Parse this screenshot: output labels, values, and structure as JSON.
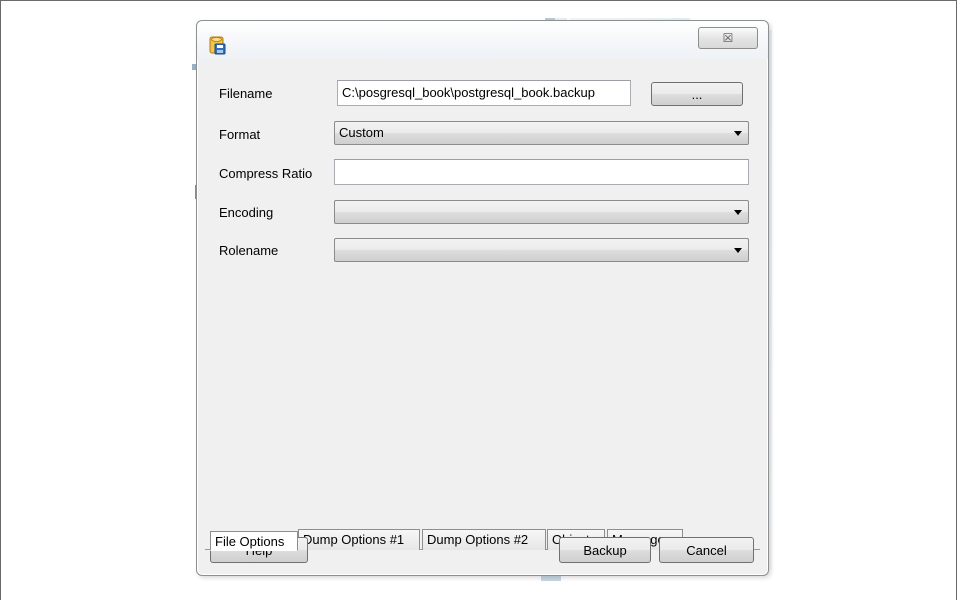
{
  "dialog": {
    "close_glyph": "☒"
  },
  "form": {
    "filename_label": "Filename",
    "filename_value": "C:\\posgresql_book\\postgresql_book.backup",
    "browse_label": "...",
    "format_label": "Format",
    "format_value": "Custom",
    "compress_label": "Compress Ratio",
    "compress_value": "",
    "encoding_label": "Encoding",
    "encoding_value": "",
    "rolename_label": "Rolename",
    "rolename_value": ""
  },
  "tabs": [
    {
      "label": "File Options",
      "active": true
    },
    {
      "label": "Dump Options #1",
      "active": false
    },
    {
      "label": "Dump Options #2",
      "active": false
    },
    {
      "label": "Objects",
      "active": false
    },
    {
      "label": "Messages",
      "active": false
    }
  ],
  "buttons": {
    "help": "Help",
    "backup": "Backup",
    "cancel": "Cancel"
  },
  "icons": {
    "app": "database-backup-icon",
    "close": "close-icon",
    "dropdown": "chevron-down-icon"
  },
  "colors": {
    "dialog_bg": "#f0f0f0",
    "border": "#8e8f8f"
  }
}
